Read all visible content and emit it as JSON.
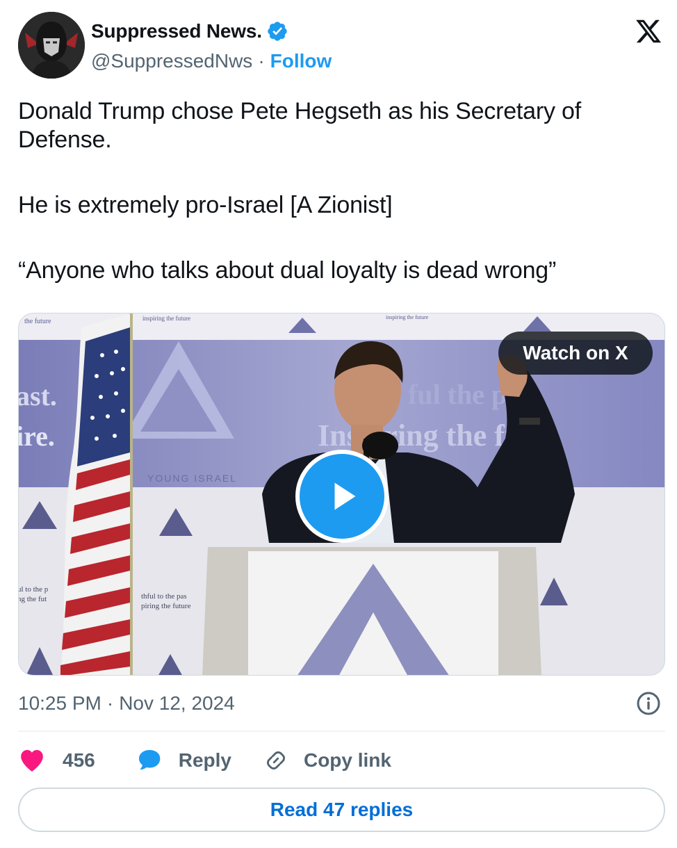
{
  "author": {
    "name": "Suppressed News.",
    "handle": "@SuppressedNws",
    "separator": "·",
    "follow_label": "Follow",
    "verified": true
  },
  "tweet": {
    "paragraphs": [
      "Donald Trump chose Pete Hegseth as his Secretary of Defense.",
      "He is extremely pro-Israel [A Zionist]",
      "“Anyone who talks about dual loyalty is dead wrong”"
    ]
  },
  "media": {
    "watch_label": "Watch on X",
    "backdrop_text": {
      "top_left_1": "ast.",
      "top_left_2": "ire.",
      "center": "Inspiring the futu",
      "upper_right": "ful the p",
      "small_left_1": "ul to the p",
      "small_left_2": "ng the fut",
      "small_mid_1": "thful to the pas",
      "small_mid_2": "piring the future",
      "banner_top_1": "the future",
      "banner_top_2": "inspiring the future",
      "banner_top_3": "inspiring the future",
      "org_name": "YOUNG ISRAEL"
    }
  },
  "footer": {
    "time": "10:25 PM",
    "separator": "·",
    "date": "Nov 12, 2024",
    "like_count": "456",
    "reply_label": "Reply",
    "copy_label": "Copy link",
    "read_replies_label": "Read 47 replies"
  },
  "colors": {
    "accent": "#1d9bf0",
    "link": "#006fd6",
    "like": "#f91880",
    "muted": "#536471",
    "text": "#0f1419"
  },
  "icons": {
    "verified": "verified-badge-icon",
    "x_logo": "x-logo-icon",
    "info": "info-icon",
    "like": "heart-icon",
    "reply": "speech-bubble-icon",
    "copy": "link-icon",
    "play": "play-icon"
  }
}
